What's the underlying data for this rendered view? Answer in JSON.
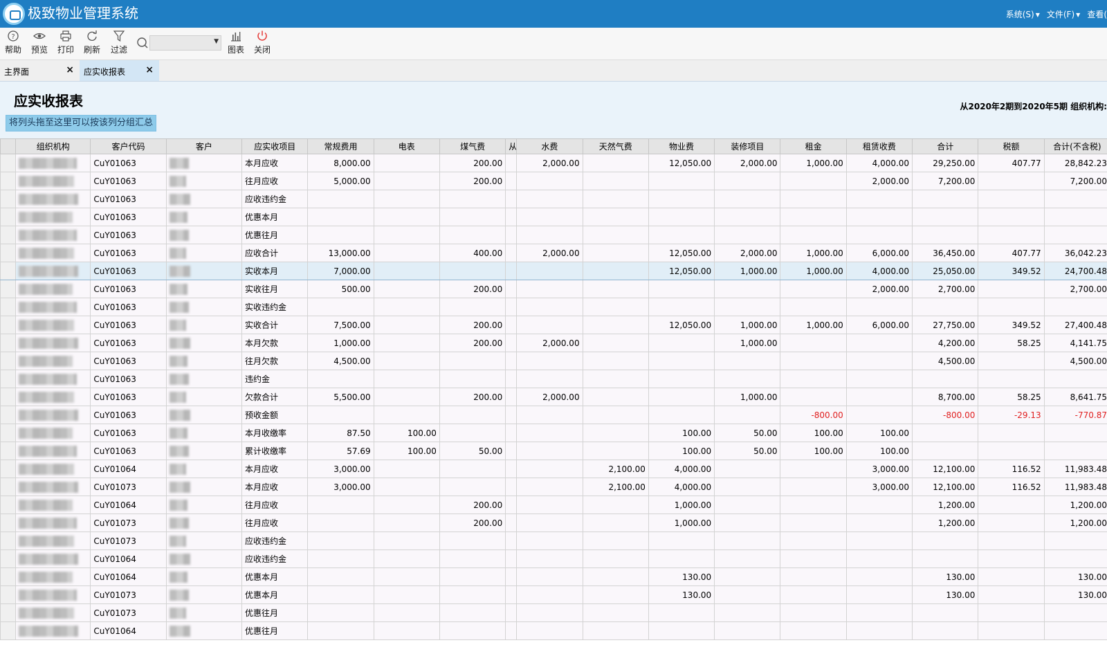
{
  "app": {
    "title": "极致物业管理系统",
    "menu": [
      "系统(S)",
      "文件(F)",
      "查看("
    ]
  },
  "toolbar": {
    "help": "帮助",
    "preview": "预览",
    "print": "打印",
    "refresh": "刷新",
    "filter": "过滤",
    "chart": "图表",
    "close": "关闭",
    "search_value": ""
  },
  "tabs": [
    {
      "label": "主界面"
    },
    {
      "label": "应实收报表"
    }
  ],
  "report": {
    "title": "应实收报表",
    "period": "从2020年2期到2020年5期 组织机构:",
    "group_hint": "将列头拖至这里可以按该列分组汇总"
  },
  "table": {
    "columns": [
      "组织机构",
      "客户代码",
      "客户",
      "应实收项目",
      "常规费用",
      "电表",
      "煤气费",
      "从",
      "水费",
      "天然气费",
      "物业费",
      "装修项目",
      "租金",
      "租赁收费",
      "合计",
      "税额",
      "合计(不含税)"
    ],
    "rows": [
      [
        "",
        "CuY01063",
        "",
        "本月应收",
        "8,000.00",
        "",
        "200.00",
        "",
        "2,000.00",
        "",
        "12,050.00",
        "2,000.00",
        "1,000.00",
        "4,000.00",
        "29,250.00",
        "407.77",
        "28,842.23"
      ],
      [
        "",
        "CuY01063",
        "",
        "往月应收",
        "5,000.00",
        "",
        "200.00",
        "",
        "",
        "",
        "",
        "",
        "",
        "2,000.00",
        "7,200.00",
        "",
        "7,200.00"
      ],
      [
        "",
        "CuY01063",
        "",
        "应收违约金",
        "",
        "",
        "",
        "",
        "",
        "",
        "",
        "",
        "",
        "",
        "",
        "",
        ""
      ],
      [
        "",
        "CuY01063",
        "",
        "优惠本月",
        "",
        "",
        "",
        "",
        "",
        "",
        "",
        "",
        "",
        "",
        "",
        "",
        ""
      ],
      [
        "",
        "CuY01063",
        "",
        "优惠往月",
        "",
        "",
        "",
        "",
        "",
        "",
        "",
        "",
        "",
        "",
        "",
        "",
        ""
      ],
      [
        "",
        "CuY01063",
        "",
        "应收合计",
        "13,000.00",
        "",
        "400.00",
        "",
        "2,000.00",
        "",
        "12,050.00",
        "2,000.00",
        "1,000.00",
        "6,000.00",
        "36,450.00",
        "407.77",
        "36,042.23"
      ],
      [
        "",
        "CuY01063",
        "",
        "实收本月",
        "7,000.00",
        "",
        "",
        "",
        "",
        "",
        "12,050.00",
        "1,000.00",
        "1,000.00",
        "4,000.00",
        "25,050.00",
        "349.52",
        "24,700.48"
      ],
      [
        "",
        "CuY01063",
        "",
        "实收往月",
        "500.00",
        "",
        "200.00",
        "",
        "",
        "",
        "",
        "",
        "",
        "2,000.00",
        "2,700.00",
        "",
        "2,700.00"
      ],
      [
        "",
        "CuY01063",
        "",
        "实收违约金",
        "",
        "",
        "",
        "",
        "",
        "",
        "",
        "",
        "",
        "",
        "",
        "",
        ""
      ],
      [
        "",
        "CuY01063",
        "",
        "实收合计",
        "7,500.00",
        "",
        "200.00",
        "",
        "",
        "",
        "12,050.00",
        "1,000.00",
        "1,000.00",
        "6,000.00",
        "27,750.00",
        "349.52",
        "27,400.48"
      ],
      [
        "",
        "CuY01063",
        "",
        "本月欠款",
        "1,000.00",
        "",
        "200.00",
        "",
        "2,000.00",
        "",
        "",
        "1,000.00",
        "",
        "",
        "4,200.00",
        "58.25",
        "4,141.75"
      ],
      [
        "",
        "CuY01063",
        "",
        "往月欠款",
        "4,500.00",
        "",
        "",
        "",
        "",
        "",
        "",
        "",
        "",
        "",
        "4,500.00",
        "",
        "4,500.00"
      ],
      [
        "",
        "CuY01063",
        "",
        "违约金",
        "",
        "",
        "",
        "",
        "",
        "",
        "",
        "",
        "",
        "",
        "",
        "",
        ""
      ],
      [
        "",
        "CuY01063",
        "",
        "欠款合计",
        "5,500.00",
        "",
        "200.00",
        "",
        "2,000.00",
        "",
        "",
        "1,000.00",
        "",
        "",
        "8,700.00",
        "58.25",
        "8,641.75"
      ],
      [
        "",
        "CuY01063",
        "",
        "预收金额",
        "",
        "",
        "",
        "",
        "",
        "",
        "",
        "",
        "-800.00",
        "",
        "-800.00",
        "-29.13",
        "-770.87"
      ],
      [
        "",
        "CuY01063",
        "",
        "本月收缴率",
        "87.50",
        "100.00",
        "",
        "",
        "",
        "",
        "100.00",
        "50.00",
        "100.00",
        "100.00",
        "",
        "",
        ""
      ],
      [
        "",
        "CuY01063",
        "",
        "累计收缴率",
        "57.69",
        "100.00",
        "50.00",
        "",
        "",
        "",
        "100.00",
        "50.00",
        "100.00",
        "100.00",
        "",
        "",
        ""
      ],
      [
        "",
        "CuY01064",
        "",
        "本月应收",
        "3,000.00",
        "",
        "",
        "",
        "",
        "2,100.00",
        "4,000.00",
        "",
        "",
        "3,000.00",
        "12,100.00",
        "116.52",
        "11,983.48"
      ],
      [
        "",
        "CuY01073",
        "",
        "本月应收",
        "3,000.00",
        "",
        "",
        "",
        "",
        "2,100.00",
        "4,000.00",
        "",
        "",
        "3,000.00",
        "12,100.00",
        "116.52",
        "11,983.48"
      ],
      [
        "",
        "CuY01064",
        "",
        "往月应收",
        "",
        "",
        "200.00",
        "",
        "",
        "",
        "1,000.00",
        "",
        "",
        "",
        "1,200.00",
        "",
        "1,200.00"
      ],
      [
        "",
        "CuY01073",
        "",
        "往月应收",
        "",
        "",
        "200.00",
        "",
        "",
        "",
        "1,000.00",
        "",
        "",
        "",
        "1,200.00",
        "",
        "1,200.00"
      ],
      [
        "",
        "CuY01073",
        "",
        "应收违约金",
        "",
        "",
        "",
        "",
        "",
        "",
        "",
        "",
        "",
        "",
        "",
        "",
        ""
      ],
      [
        "",
        "CuY01064",
        "",
        "应收违约金",
        "",
        "",
        "",
        "",
        "",
        "",
        "",
        "",
        "",
        "",
        "",
        "",
        ""
      ],
      [
        "",
        "CuY01064",
        "",
        "优惠本月",
        "",
        "",
        "",
        "",
        "",
        "",
        "130.00",
        "",
        "",
        "",
        "130.00",
        "",
        "130.00"
      ],
      [
        "",
        "CuY01073",
        "",
        "优惠本月",
        "",
        "",
        "",
        "",
        "",
        "",
        "130.00",
        "",
        "",
        "",
        "130.00",
        "",
        "130.00"
      ],
      [
        "",
        "CuY01073",
        "",
        "优惠往月",
        "",
        "",
        "",
        "",
        "",
        "",
        "",
        "",
        "",
        "",
        "",
        "",
        ""
      ],
      [
        "",
        "CuY01064",
        "",
        "优惠往月",
        "",
        "",
        "",
        "",
        "",
        "",
        "",
        "",
        "",
        "",
        "",
        "",
        ""
      ]
    ],
    "selected_row": 6
  },
  "colors": {
    "titlebar": "#1f7ec3",
    "selected_row": "#e1eef7",
    "negative": "#e02020",
    "group_hint_bg": "#8ecbea"
  }
}
